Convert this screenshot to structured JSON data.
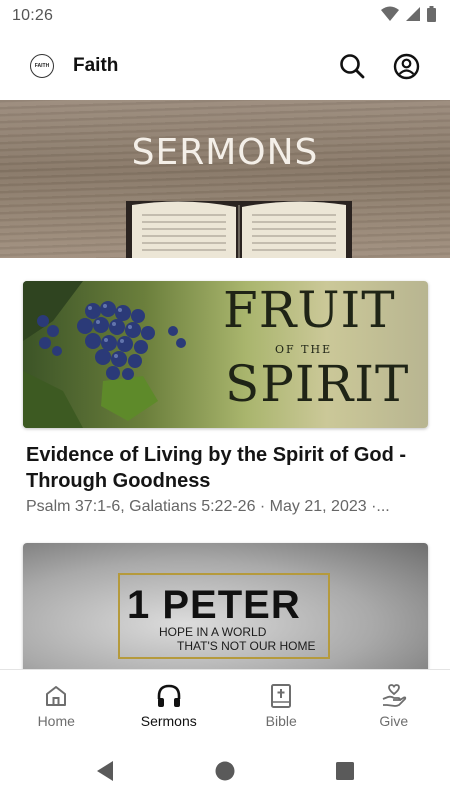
{
  "status_bar": {
    "time": "10:26"
  },
  "app_bar": {
    "logo_text": "FAITH",
    "title": "Faith"
  },
  "banner": {
    "title": "SERMONS"
  },
  "sermons": [
    {
      "artwork": {
        "line1": "FRUIT",
        "line2": "OF THE",
        "line3": "SPIRIT"
      },
      "title": "Evidence of Living by the Spirit of God - Through Goodness",
      "meta": "Psalm 37:1-6, Galatians 5:22-26 · May 21, 2023 ·..."
    },
    {
      "artwork": {
        "line1": "1 PETER",
        "line2": "HOPE IN A WORLD",
        "line3": "THAT'S NOT OUR HOME"
      }
    }
  ],
  "bottom_nav": {
    "items": [
      {
        "label": "Home",
        "icon": "home-icon"
      },
      {
        "label": "Sermons",
        "icon": "headphones-icon"
      },
      {
        "label": "Bible",
        "icon": "bible-icon"
      },
      {
        "label": "Give",
        "icon": "heart-hand-icon"
      }
    ],
    "active": "Sermons"
  },
  "colors": {
    "active": "#111111",
    "inactive": "#6e6e6e",
    "gold_frame": "#b59a3c"
  }
}
